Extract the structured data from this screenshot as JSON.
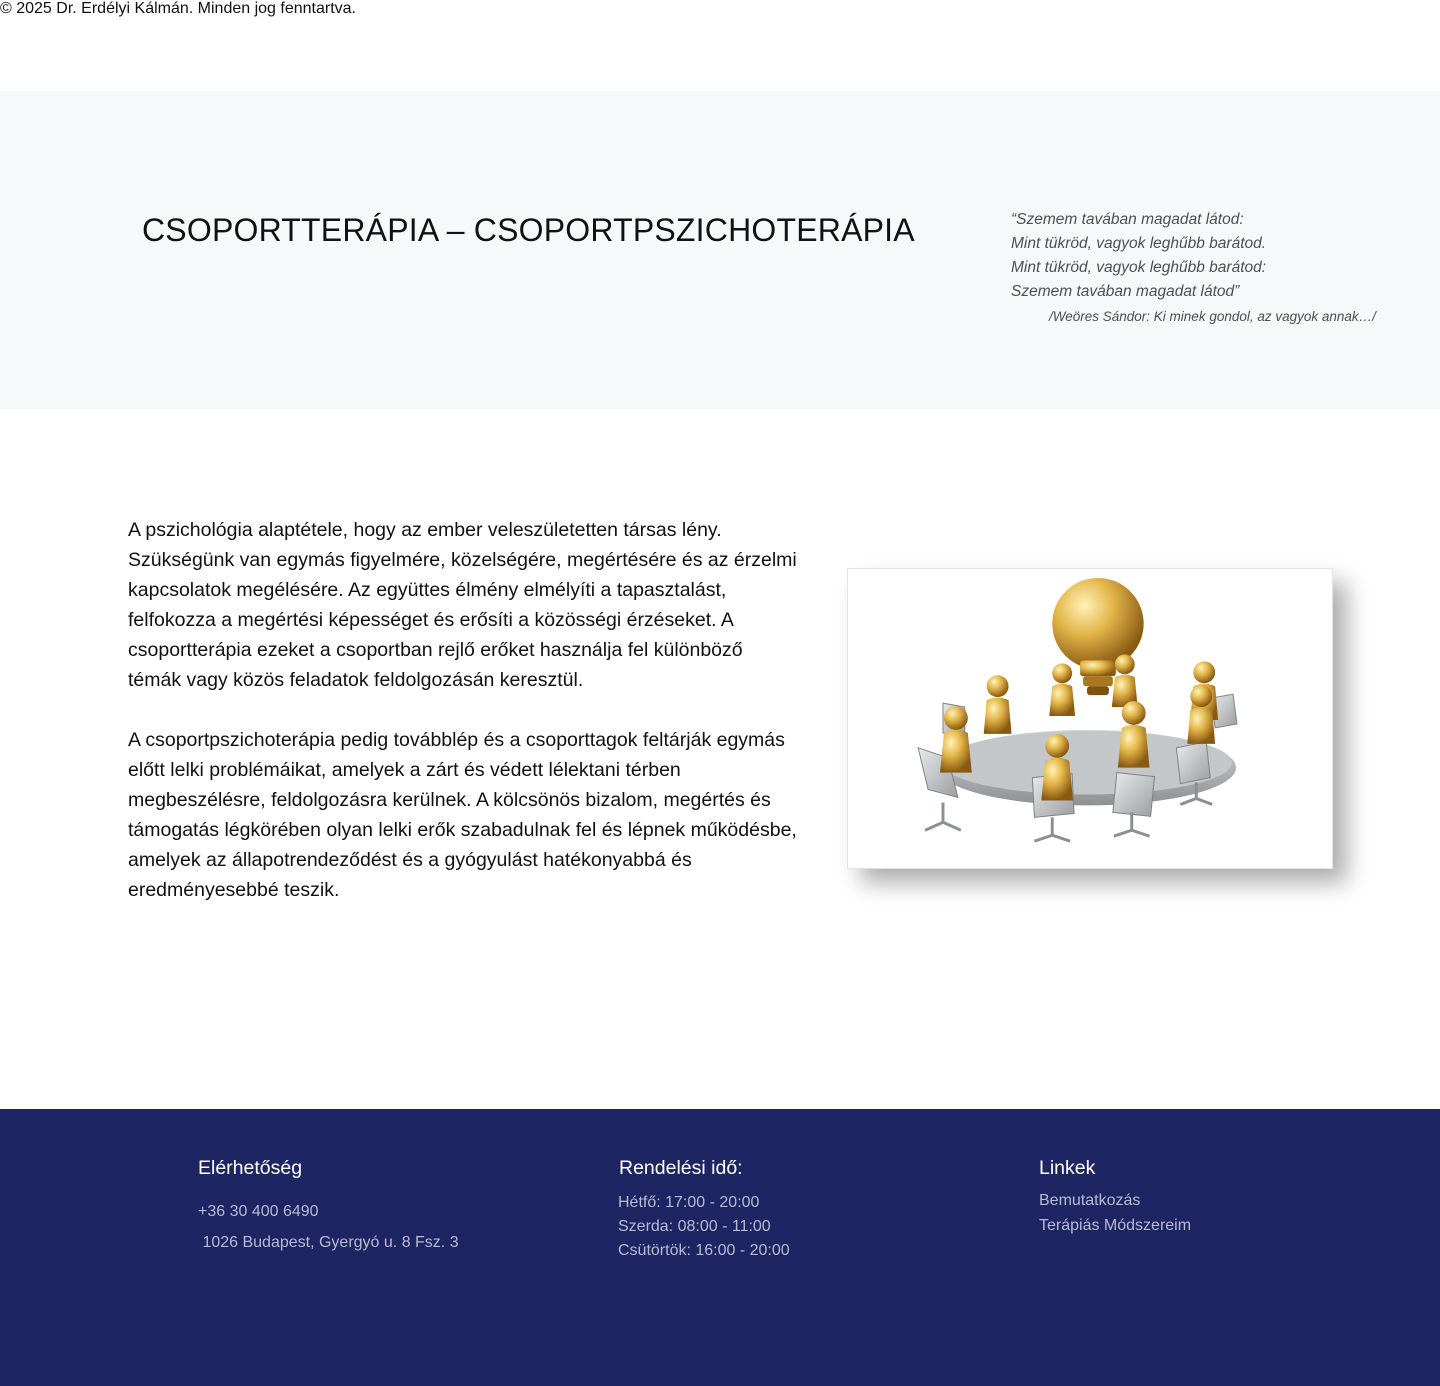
{
  "hero": {
    "title": "CSOPORTTERÁPIA – CSOPORTPSZICHOTERÁPIA",
    "quote_lines": [
      "“Szemem tavában magadat látod:",
      "Mint tükröd, vagyok leghűbb barátod.",
      "Mint tükröd, vagyok leghűbb barátod:",
      "Szemem tavában magadat látod”"
    ],
    "quote_source": "/Weöres Sándor: Ki minek gondol, az vagyok annak…/"
  },
  "content": {
    "paragraphs": [
      "A pszichológia alaptétele, hogy az ember veleszületetten társas lény. Szükségünk van egymás figyelmére, közelségére, megértésére és az érzelmi kapcsolatok megélésére. Az együttes élmény elmélyíti a tapasztalást, felfokozza a megértési képességet és erősíti a közösségi érzéseket. A csoportterápia ezeket a csoportban rejlő erőket használja fel különböző témák vagy közös feladatok feldolgozásán keresztül.",
      "A csoportpszichoterápia pedig továbblép és a csoporttagok feltárják egymás előtt lelki problémáikat, amelyek a zárt és védett lélektani térben megbeszélésre, feldolgozásra kerülnek. A kölcsönös bizalom, megértés és támogatás légkörében olyan lelki erők szabadulnak fel és lépnek működésbe, amelyek az állapotrendeződést és a gyógyulást hatékonyabbá és eredményesebbé teszik."
    ],
    "image_icon": "golden-figures-around-table-with-lightbulb"
  },
  "footer": {
    "contact": {
      "heading": "Elérhetőség",
      "phone": "+36 30 400 6490",
      "address": " 1026 Budapest, Gyergyó u. 8 Fsz. 3"
    },
    "hours": {
      "heading": "Rendelési idő:",
      "lines": [
        "Hétfő: 17:00 - 20:00",
        "Szerda: 08:00 - 11:00",
        "Csütörtök: 16:00 - 20:00"
      ]
    },
    "links": {
      "heading": "Linkek",
      "items": [
        "Bemutatkozás",
        "Terápiás Módszereim"
      ]
    },
    "copyright": "© 2025 Dr. Erdélyi Kálmán. Minden jog fenntartva."
  },
  "colors": {
    "hero_bg": "#f7f8fa",
    "footer_bg": "#1d2563",
    "footer_text": "#b7bbd2",
    "gold": "#d4a132"
  }
}
